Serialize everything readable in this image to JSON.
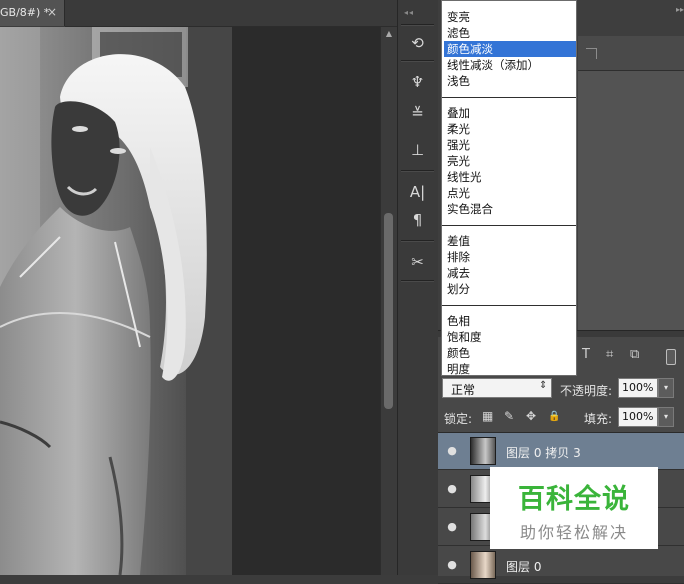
{
  "document": {
    "tab_title": "GB/8#) *",
    "tab_close": "×"
  },
  "blend_menu": {
    "groups": [
      [
        "变亮",
        "滤色",
        "颜色减淡",
        "线性减淡（添加）",
        "浅色"
      ],
      [
        "叠加",
        "柔光",
        "强光",
        "亮光",
        "线性光",
        "点光",
        "实色混合"
      ],
      [
        "差值",
        "排除",
        "减去",
        "划分"
      ],
      [
        "色相",
        "饱和度",
        "颜色",
        "明度"
      ]
    ],
    "selected": "颜色减淡"
  },
  "layers": {
    "blend_mode": "正常",
    "opacity_label": "不透明度:",
    "opacity_value": "100%",
    "lock_label": "锁定:",
    "fill_label": "填充:",
    "fill_value": "100%",
    "items": [
      {
        "name": "图层 0 拷贝 3",
        "active": true
      },
      {
        "name": "",
        "active": false
      },
      {
        "name": "",
        "active": false
      },
      {
        "name": "图层 0",
        "active": false
      }
    ]
  },
  "icons": {
    "tools": [
      "history-icon",
      "brush-preset-icon",
      "brush-options-icon",
      "clone-source-icon",
      "character-icon",
      "paragraph-icon",
      "tool-preset-icon"
    ],
    "filter": [
      "type-filter-icon",
      "shape-filter-icon",
      "smart-object-filter-icon"
    ],
    "lock": [
      "lock-transparent-icon",
      "lock-paint-icon",
      "lock-position-icon",
      "lock-all-icon"
    ]
  },
  "glyphs": {
    "history": "⟲",
    "brush_preset": "♆",
    "brush_options": "≚",
    "clone_source": "⊥",
    "character": "A|",
    "paragraph": "¶",
    "tool_preset": "✂",
    "type_filter": "T",
    "shape_filter": "⌗",
    "smart_filter": "⧉",
    "eye": "●",
    "lock_trans": "▦",
    "lock_paint": "✎",
    "lock_move": "✥",
    "lock_all": "🔒",
    "dropdown_arrow": "▾",
    "updown_arrow": "⇕",
    "scroll_up": "▲"
  },
  "watermark": {
    "title": "百科全说",
    "subtitle": "助你轻松解决"
  },
  "colors": {
    "selection": "#3374d6",
    "active_layer": "#6e7f92",
    "watermark_green": "#3ab43a"
  }
}
